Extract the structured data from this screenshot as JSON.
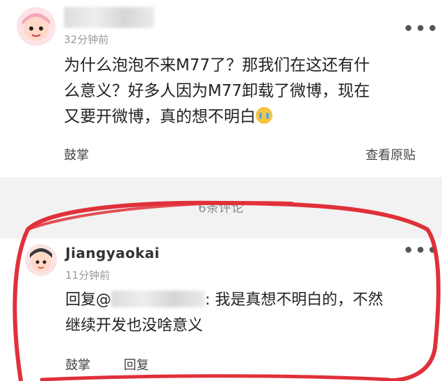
{
  "post": {
    "time": "32分钟前",
    "content_line1": "为什么泡泡不来M77了？那我们在这还有什",
    "content_line2": "么意义？好多人因为M77卸载了微博，现在",
    "content_line3": "又要开微博，真的想不明白",
    "more_icon": "more-dots-icon",
    "like_label": "鼓掌",
    "view_original_label": "查看原贴"
  },
  "comments_section": {
    "label": "6条评论"
  },
  "comment": {
    "username": "Jiangyaokai",
    "time": "11分钟前",
    "reply_prefix": "回复@",
    "reply_text": ": 我是真想不明白的，不然",
    "reply_line2": "继续开发也没啥意义",
    "like_label": "鼓掌",
    "reply_label": "回复"
  },
  "colors": {
    "annotation_red": "#e0303a",
    "divider_bg": "#f2f2f2"
  }
}
